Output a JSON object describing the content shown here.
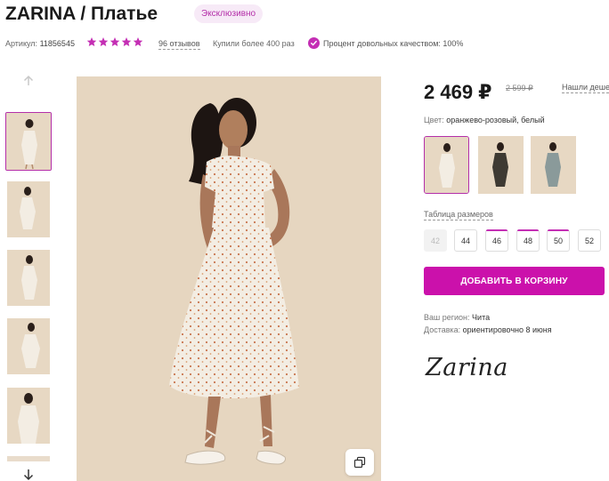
{
  "product": {
    "title": "ZARINA / Платье",
    "badge": "Эксклюзивно"
  },
  "meta": {
    "article_label": "Артикул:",
    "article_value": "11856545",
    "rating": 5,
    "reviews": "96 отзывов",
    "bought": "Купили более 400 раз",
    "quality": "Процент довольных качеством: 100%"
  },
  "price": {
    "current": "2 469 ₽",
    "old": "2 599 ₽",
    "cheaper_link": "Нашли дешевле?"
  },
  "color": {
    "label": "Цвет:",
    "value": "оранжево-розовый, белый"
  },
  "sizes": {
    "table_link": "Таблица размеров",
    "items": [
      {
        "label": "42",
        "available": false
      },
      {
        "label": "44",
        "available": true
      },
      {
        "label": "46",
        "available": true
      },
      {
        "label": "48",
        "available": true
      },
      {
        "label": "50",
        "available": true
      },
      {
        "label": "52",
        "available": true
      }
    ]
  },
  "cart": {
    "add_label": "ДОБАВИТЬ В КОРЗИНУ"
  },
  "delivery": {
    "region_label": "Ваш регион:",
    "region_value": "Чита",
    "delivery_label": "Доставка:",
    "delivery_value": "ориентировочно 8 июня"
  },
  "brand": {
    "logo_text": "Zarina"
  },
  "colors": {
    "accent": "#cb11ab",
    "star": "#c42fb4",
    "image_bg": "#e6d6c0"
  },
  "icons": {
    "up": "chevron-up-icon",
    "down": "arrow-down-icon",
    "copy": "copy-icon",
    "check": "check-circle-icon"
  }
}
